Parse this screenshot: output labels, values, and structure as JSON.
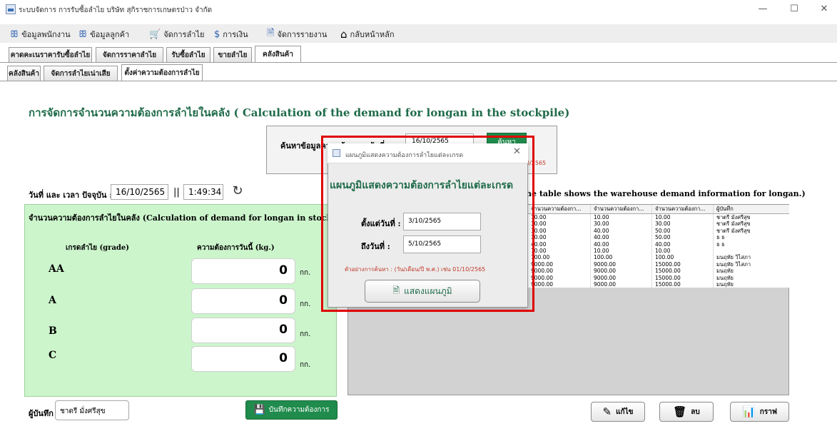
{
  "window": {
    "title": "ระบบจัดการ การรับซื้อลำไย บริษัท สุกิราชการเกษตรป่าว จำกัด",
    "minimize": "—",
    "maximize": "☐",
    "close": "✕"
  },
  "menu": [
    {
      "icon": "ꕥ",
      "label": "ข้อมูลพนักงาน"
    },
    {
      "icon": "ꕥ",
      "label": "ข้อมูลลูกค้า"
    },
    {
      "icon": "🛒",
      "label": "จัดการลำไย"
    },
    {
      "icon": "$",
      "label": "การเงิน"
    },
    {
      "icon": "🗎",
      "label": "จัดการรายงาน"
    },
    {
      "icon": "⌂",
      "label": "กลับหน้าหลัก"
    }
  ],
  "tabs_main": [
    "คาดคะเนราคารับซื้อลำไย",
    "จัดการราคาลำไย",
    "รับซื้อลำไย",
    "ขายลำไย",
    "คลังสินค้า"
  ],
  "tabs_sub": [
    "คลังสินค้า",
    "จัดการลำไยเน่าเสีย",
    "ตั้งค่าความต้องการลำไย"
  ],
  "page_title": "การจัดการจำนวนความต้องการลำไยในคลัง ( Calculation of the demand for longan in the stockpile)",
  "search": {
    "label": "ค้นหาข้อมูลความต้องการ วันที่ :",
    "value": "16/10/2565",
    "button": "ค้นหา",
    "hint": "0/2565"
  },
  "datetime": {
    "label": "วันที่ และ เวลา ปัจจุบัน :",
    "date": "16/10/2565",
    "sep": "||",
    "time": "1:49:34"
  },
  "demand_panel": {
    "title": "จำนวนความต้องการลำไยในคลัง (Calculation of demand for longan in stock)",
    "grade_header": "เกรดลำไย (grade)",
    "qty_header": "ความต้องการวันนี้ (kg.)",
    "unit": "กก.",
    "rows": [
      {
        "grade": "AA",
        "value": "0"
      },
      {
        "grade": "A",
        "value": "0"
      },
      {
        "grade": "B",
        "value": "0"
      },
      {
        "grade": "C",
        "value": "0"
      }
    ]
  },
  "recorder": {
    "label": "ผู้บันทึก",
    "value": "ชาตรี มั่งศรีสุข"
  },
  "save_button": "บันทึกความต้องการ",
  "table": {
    "heading": "he table shows the warehouse demand information for longan.)",
    "columns": [
      "จำนวนความต้องกา...",
      "จำนวนความต้องกา...",
      "จำนวนความต้องกา...",
      "ผู้บันทึก"
    ],
    "rows": [
      [
        "10.00",
        "10.00",
        "10.00",
        "ชาตรี มั่งศรีสุข"
      ],
      [
        "30.00",
        "30.00",
        "30.00",
        "ชาตรี มั่งศรีสุข"
      ],
      [
        "30.00",
        "40.00",
        "50.00",
        "ชาตรี มั่งศรีสุข"
      ],
      [
        "30.00",
        "40.00",
        "50.00",
        "ธ ธ"
      ],
      [
        "40.00",
        "40.00",
        "40.00",
        "ธ ธ"
      ],
      [
        "10.00",
        "10.00",
        "10.00",
        ""
      ],
      [
        "100.00",
        "100.00",
        "100.00",
        "มนฤทัย วิไสภา"
      ],
      [
        "9000.00",
        "9000.00",
        "15000.00",
        "มนฤทัย วิไสภา"
      ],
      [
        "9000.00",
        "9000.00",
        "15000.00",
        "มนฤทัย"
      ],
      [
        "9000.00",
        "9000.00",
        "15000.00",
        "มนฤทัย"
      ],
      [
        "9000.00",
        "9000.00",
        "15000.00",
        "มนฤทัย"
      ]
    ]
  },
  "buttons": {
    "edit": "แก้ไข",
    "delete": "ลบ",
    "graph": "กราฟ"
  },
  "dialog": {
    "window_title": "แผนภูมิแสดงความต้องการลำไยแต่ละเกรด",
    "heading": "แผนภูมิแสดงความต้องการลำไยแต่ละเกรด",
    "from_label": "ตั้งแต่วันที่ :",
    "from_value": "3/10/2565",
    "to_label": "ถึงวันที่ :",
    "to_value": "5/10/2565",
    "hint": "ตัวอย่างการค้นหา : (วัน/เดือน/ปี พ.ศ.) เช่น 01/10/2565",
    "button": "แสดงแผนภูมิ",
    "close": "✕"
  },
  "colors": {
    "accent_green": "#1f8b4c",
    "panel_green": "#ccf5cc",
    "highlight": "#e00000",
    "title_green": "#1f6b4a"
  }
}
